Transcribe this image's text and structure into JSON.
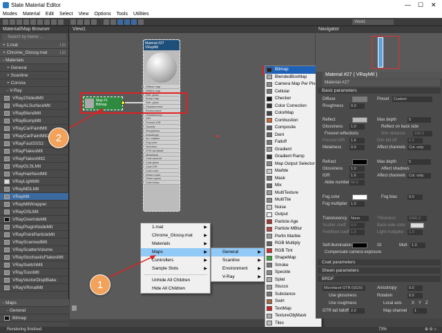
{
  "window": {
    "title": "Slate Material Editor",
    "controls": [
      "—",
      "☐",
      "✕"
    ]
  },
  "menubar": [
    "Modes",
    "Material",
    "Edit",
    "Select",
    "View",
    "Options",
    "Tools",
    "Utilities"
  ],
  "toolbar": {
    "view_select": "View1"
  },
  "browser": {
    "header": "Material/Map Browser",
    "search_placeholder": "Search by Name ...",
    "items": [
      {
        "label": "+ 1.mat",
        "lib": "Lib",
        "kind": "grp"
      },
      {
        "label": "+ Chrome_Glossy.mat",
        "lib": "Lib",
        "kind": "grp"
      },
      {
        "label": "- Materials",
        "kind": "grp"
      },
      {
        "label": "+ General",
        "kind": "sub"
      },
      {
        "label": "+ Scanline",
        "kind": "sub"
      },
      {
        "label": "+ Corona",
        "kind": "sub"
      },
      {
        "label": "- V-Ray",
        "kind": "sub"
      },
      {
        "label": "VRay2SidedMtl",
        "kind": "mat"
      },
      {
        "label": "VRayALSurfaceMtl",
        "kind": "mat"
      },
      {
        "label": "VRayBlendMtl",
        "kind": "mat"
      },
      {
        "label": "VRayBumpMtl",
        "kind": "mat"
      },
      {
        "label": "VRayCarPaintMtl",
        "kind": "mat"
      },
      {
        "label": "VRayCarPaintMtl2",
        "kind": "mat"
      },
      {
        "label": "VRayFastSSS2",
        "kind": "mat"
      },
      {
        "label": "VRayFlakesMtl",
        "kind": "mat"
      },
      {
        "label": "VRayFlakesMtl2",
        "kind": "mat"
      },
      {
        "label": "VRayGLSLMtl",
        "kind": "mat"
      },
      {
        "label": "VRayHairNextMtl",
        "kind": "mat"
      },
      {
        "label": "VRayLightMtl",
        "kind": "mat",
        "sw": "lt"
      },
      {
        "label": "VRayMDLMtl",
        "kind": "mat"
      },
      {
        "label": "VRayMtl",
        "kind": "mat",
        "selected": true
      },
      {
        "label": "VRayMtlWrapper",
        "kind": "mat"
      },
      {
        "label": "VRayOSLMtl",
        "kind": "mat"
      },
      {
        "label": "VRayOverrideMtl",
        "kind": "mat",
        "sw": "dk"
      },
      {
        "label": "VRayPluginNodeMtl",
        "kind": "mat"
      },
      {
        "label": "VRayPointParticleMtl",
        "kind": "mat"
      },
      {
        "label": "VRayScannedMtl",
        "kind": "mat"
      },
      {
        "label": "VRayScatterVolume",
        "kind": "mat"
      },
      {
        "label": "VRayStochasticFlakesMtl",
        "kind": "mat"
      },
      {
        "label": "VRaySwitchMtl",
        "kind": "mat"
      },
      {
        "label": "VRayToonMtl",
        "kind": "mat"
      },
      {
        "label": "VRayVectorDisplBake",
        "kind": "mat"
      },
      {
        "label": "VRayVRmatMtl",
        "kind": "mat"
      }
    ],
    "maps_section": "- Maps",
    "maps_general": "- General",
    "maps_first": "Bitmap"
  },
  "view": {
    "tab": "View1"
  },
  "material_node": {
    "title_line1": "Material #27",
    "title_line2": "VRayMtl",
    "slots": [
      "Diffuse map",
      "Reflect map",
      "Refl. gloss",
      "Bump map",
      "Refr. gloss",
      "Displacement",
      "Environment",
      "Translucency",
      "IOR",
      "Fresnel IOR",
      "Opacity",
      "Roughness",
      "Anisotropy",
      "An. rotation",
      "Fog color",
      "Self-illum",
      "GTR tail falloff",
      "Metalness",
      "Coat amount",
      "Coat gloss",
      "Coat IOR",
      "Coat color",
      "Sheen color",
      "Sheen gloss",
      "Coat bump"
    ]
  },
  "map_node": {
    "title_line1": "Map #1",
    "title_line2": "Bitmap"
  },
  "callouts": [
    "1",
    "2"
  ],
  "menu1": {
    "items": [
      {
        "label": "1.mat",
        "sub": true
      },
      {
        "label": "Chrome_Glossy.mat",
        "sub": true
      },
      {
        "label": "Materials",
        "sub": true
      },
      {
        "label": "Maps",
        "sub": true,
        "selected": true
      },
      {
        "label": "Controllers",
        "sub": true
      },
      {
        "label": "Sample Slots",
        "sub": true
      },
      {
        "label": "sep"
      },
      {
        "label": "Unhide All Children"
      },
      {
        "label": "Hide All Children"
      }
    ]
  },
  "menu2": {
    "items": [
      {
        "label": "General",
        "sub": true,
        "selected": true
      },
      {
        "label": "Scanline",
        "sub": true
      },
      {
        "label": "Environment",
        "sub": true
      },
      {
        "label": "V-Ray",
        "sub": true
      }
    ]
  },
  "menu3": {
    "items": [
      "Bitmap",
      "BlendedBoxMap",
      "Camera Map Per Pixel",
      "Cellular",
      "Checker",
      "Color Correction",
      "ColorMap",
      "Combustion",
      "Composite",
      "Dent",
      "Falloff",
      "Gradient",
      "Gradient Ramp",
      "Map Output Selector",
      "Marble",
      "Mask",
      "Mix",
      "MultiTexture",
      "MultiTile",
      "Noise",
      "Output",
      "Particle Age",
      "Particle MBlur",
      "Perlin Marble",
      "RGB Multiply",
      "RGB Tint",
      "ShapeMap",
      "Smoke",
      "Speckle",
      "Splat",
      "Stucco",
      "Substance",
      "Swirl",
      "TextMap",
      "TextureObjMask",
      "Tiles"
    ],
    "selected": "Bitmap"
  },
  "navigator": {
    "title": "Navigator"
  },
  "panel": {
    "header": "Material #27  ( VRayMtl )",
    "name": "Material #27",
    "basic_params": "Basic parameters",
    "diffuse": "Diffuse",
    "preset": "Preset",
    "preset_value": "Custom",
    "roughness": "Roughness",
    "roughness_val": "0.0",
    "reflect": "Reflect",
    "max_depth": "Max depth",
    "max_depth_val": "5",
    "glossiness": "Glossiness",
    "glossiness_val": "1.0",
    "reflect_backside": "Reflect on back side",
    "fresnel": "Fresnel reflections",
    "dim_distance": "Dim distance",
    "dim_distance_val": "100.0",
    "fresnel_ior": "Fresnel IOR",
    "fresnel_ior_val": "1.6",
    "dim_falloff": "Dim fall off",
    "dim_falloff_val": "0.0",
    "metalness": "Metalness",
    "metalness_val": "0.0",
    "affect_channels": "Affect channels",
    "affect_channels_val": "Col. only",
    "refract": "Refract",
    "refr_max_depth": "Max depth",
    "refr_max_depth_val": "5",
    "refr_gloss": "Glossiness",
    "refr_gloss_val": "1.0",
    "affect_shadows": "Affect shadows",
    "ior": "IOR",
    "ior_val": "1.6",
    "refr_affect_channels": "Affect channels",
    "refr_affect_channels_val": "Col. only",
    "abbe": "Abbe number",
    "abbe_val": "50.0",
    "fog_color": "Fog color",
    "fog_bias": "Fog bias",
    "fog_bias_val": "0.0",
    "fog_mult": "Fog multiplier",
    "fog_mult_val": "1.0",
    "translucency": "Translucency",
    "translucency_val": "None",
    "thickness": "Thickness",
    "thickness_val": "1000.0",
    "scatter_coeff": "Scatter coeff",
    "scatter_coeff_val": "0.0",
    "backside_color": "Back-side color",
    "fwd_bwd": "Fwd/bwd coeff",
    "fwd_bwd_val": "1.0",
    "light_mult": "Light multiplier",
    "light_mult_val": "1.0",
    "self_illum": "Self-illumination",
    "gi": "GI",
    "mult": "Mult",
    "mult_val": "1.0",
    "compensate": "Compensate camera exposure",
    "coat_params": "Coat parameters",
    "sheen_params": "Sheen parameters",
    "brdf": "BRDF",
    "brdf_type": "Microfacet GTR (GGX)",
    "anisotropy": "Anisotropy",
    "anisotropy_val": "0.0",
    "use_glossiness": "Use glossiness",
    "rotation": "Rotation",
    "rotation_val": "0.0",
    "use_roughness": "Use roughness",
    "local_axis": "Local axis",
    "axes": [
      "X",
      "Y",
      "Z"
    ],
    "gtr_tail": "GTR tail falloff",
    "gtr_tail_val": "2.0",
    "map_channel": "Map channel",
    "map_channel_val": "1"
  },
  "status": {
    "text": "Rendering finished",
    "zoom": "73%"
  }
}
